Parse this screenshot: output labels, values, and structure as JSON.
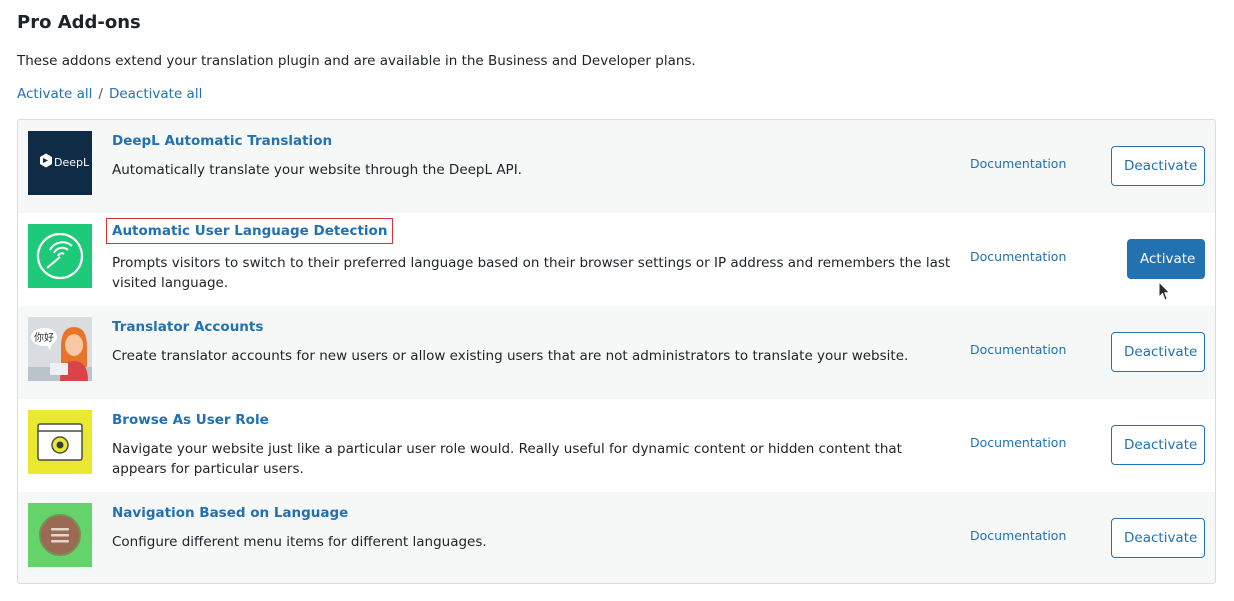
{
  "page": {
    "title": "Pro Add-ons",
    "intro": "These addons extend your translation plugin and are available in the Business and Developer plans.",
    "activate_all": "Activate all",
    "separator": "/",
    "deactivate_all": "Deactivate all"
  },
  "addons": [
    {
      "name": "DeepL Automatic Translation",
      "description": "Automatically translate your website through the DeepL API.",
      "doc_label": "Documentation",
      "button_label": "Deactivate",
      "status": "active",
      "logo_text": "DeepL",
      "icon": "deepl-logo-icon"
    },
    {
      "name": "Automatic User Language Detection",
      "description": "Prompts visitors to switch to their preferred language based on their browser settings or IP address and remembers the last visited language.",
      "doc_label": "Documentation",
      "button_label": "Activate",
      "status": "inactive",
      "icon": "language-detection-icon"
    },
    {
      "name": "Translator Accounts",
      "description": "Create translator accounts for new users or allow existing users that are not administrators to translate your website.",
      "doc_label": "Documentation",
      "button_label": "Deactivate",
      "status": "active",
      "bubble_text": "你好",
      "icon": "translator-person-icon"
    },
    {
      "name": "Browse As User Role",
      "description": "Navigate your website just like a particular user role would. Really useful for dynamic content or hidden content that appears for particular users.",
      "doc_label": "Documentation",
      "button_label": "Deactivate",
      "status": "active",
      "icon": "browser-eye-icon"
    },
    {
      "name": "Navigation Based on Language",
      "description": "Configure different menu items for different languages.",
      "doc_label": "Documentation",
      "button_label": "Deactivate",
      "status": "active",
      "icon": "menu-hamburger-icon"
    }
  ],
  "colors": {
    "link": "#2271b1",
    "primary_button": "#2271b1",
    "highlight_border": "#d63638"
  }
}
